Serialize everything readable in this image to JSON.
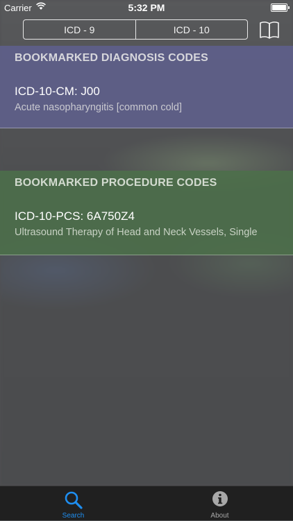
{
  "status_bar": {
    "carrier": "Carrier",
    "time": "5:32 PM"
  },
  "nav": {
    "segments": [
      "ICD - 9",
      "ICD - 10"
    ],
    "bookmarks_icon": "book-icon"
  },
  "diagnosis": {
    "header": "BOOKMARKED DIAGNOSIS CODES",
    "code": "ICD-10-CM: J00",
    "description": "Acute nasopharyngitis [common cold]"
  },
  "procedure": {
    "header": "BOOKMARKED PROCEDURE CODES",
    "code": "ICD-10-PCS: 6A750Z4",
    "description": "Ultrasound Therapy of Head and Neck Vessels, Single"
  },
  "tabbar": {
    "search_label": "Search",
    "about_label": "About",
    "search_icon": "search-icon",
    "about_icon": "info-icon",
    "active_color": "#1e8ef0",
    "inactive_color": "#a8a8a8"
  },
  "colors": {
    "diagnosis_section": "#5e608c",
    "procedure_section": "#4c704a"
  }
}
